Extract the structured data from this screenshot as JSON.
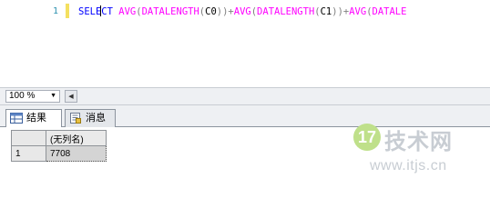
{
  "editor": {
    "line_number": "1",
    "code_tokens": [
      {
        "text": "SELE",
        "cls": "kw"
      },
      {
        "caret": true
      },
      {
        "text": "CT",
        "cls": "kw"
      },
      {
        "text": " ",
        "cls": "id"
      },
      {
        "text": "AVG",
        "cls": "fn"
      },
      {
        "text": "(",
        "cls": "op"
      },
      {
        "text": "DATALENGTH",
        "cls": "fn"
      },
      {
        "text": "(",
        "cls": "op"
      },
      {
        "text": "C0",
        "cls": "id"
      },
      {
        "text": "))+",
        "cls": "op"
      },
      {
        "text": "AVG",
        "cls": "fn"
      },
      {
        "text": "(",
        "cls": "op"
      },
      {
        "text": "DATALENGTH",
        "cls": "fn"
      },
      {
        "text": "(",
        "cls": "op"
      },
      {
        "text": "C1",
        "cls": "id"
      },
      {
        "text": "))+",
        "cls": "op"
      },
      {
        "text": "AVG",
        "cls": "fn"
      },
      {
        "text": "(",
        "cls": "op"
      },
      {
        "text": "DATALE",
        "cls": "fn"
      }
    ],
    "colors": {
      "keyword": "#0000ff",
      "function": "#ff00ff",
      "operator": "#808080"
    }
  },
  "zoom": {
    "value": "100 %"
  },
  "tabs": [
    {
      "label": "结果",
      "icon": "grid-icon",
      "active": true
    },
    {
      "label": "消息",
      "icon": "messages-icon",
      "active": false
    }
  ],
  "results": {
    "columns": [
      "(无列名)"
    ],
    "rows": [
      {
        "row_number": "1",
        "cells": [
          "7708"
        ]
      }
    ]
  },
  "watermark": {
    "badge": "17",
    "brand": "技术网",
    "url": "www.itjs.cn"
  }
}
